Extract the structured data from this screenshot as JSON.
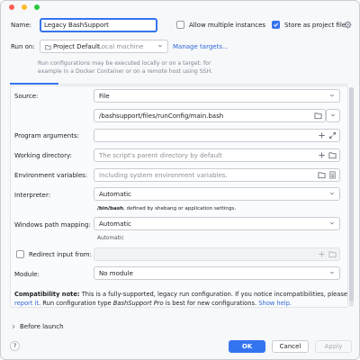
{
  "window": {
    "name_label": "Name:",
    "name_value": "Legacy BashSupport",
    "allow_multiple_label": "Allow multiple instances",
    "store_as_file_label": "Store as project file",
    "run_on_label": "Run on:",
    "run_on_value": "Project Default",
    "run_on_secondary": "Local machine",
    "manage_targets": "Manage targets...",
    "run_on_help_line1": "Run configurations may be executed locally or on a target: for",
    "run_on_help_line2": "example in a Docker Container or on a remote host using SSH."
  },
  "form": {
    "source_label": "Source:",
    "source_value": "File",
    "file_path": "/bashsupport/files/runConfig/main.bash",
    "program_args_label": "Program arguments:",
    "working_dir_label": "Working directory:",
    "working_dir_placeholder": "The script's parent directory by default",
    "env_vars_label": "Environment variables:",
    "env_vars_placeholder": "Including system environment variables.",
    "interpreter_label": "Interpreter:",
    "interpreter_value": "Automatic",
    "interpreter_hint_bold": "/bin/bash",
    "interpreter_hint_rest": ", defined by shebang or application settings.",
    "windows_path_label": "Windows path mapping:",
    "windows_path_value": "Automatic",
    "windows_path_hint": "Automatic",
    "redirect_label": "Redirect input from:",
    "module_label": "Module:",
    "module_value": "No module",
    "compat_bold": "Compatibility note:",
    "compat_text1": " This is a fully-supported, legacy run configuration. If you notice incompatibilities, please",
    "compat_report": "report it",
    "compat_text2": ". Run configuration type ",
    "compat_italic": "BashSupport Pro",
    "compat_text3": " is best for new configurations.",
    "compat_show_help": "Show help."
  },
  "footer": {
    "before_launch": "Before launch",
    "help_glyph": "?",
    "ok": "OK",
    "cancel": "Cancel",
    "apply": "Apply"
  },
  "colors": {
    "accent": "#3574f0",
    "link": "#2f67d9",
    "traffic_red": "#ff5f57",
    "traffic_yellow": "#febc2e",
    "traffic_green": "#28c840"
  }
}
